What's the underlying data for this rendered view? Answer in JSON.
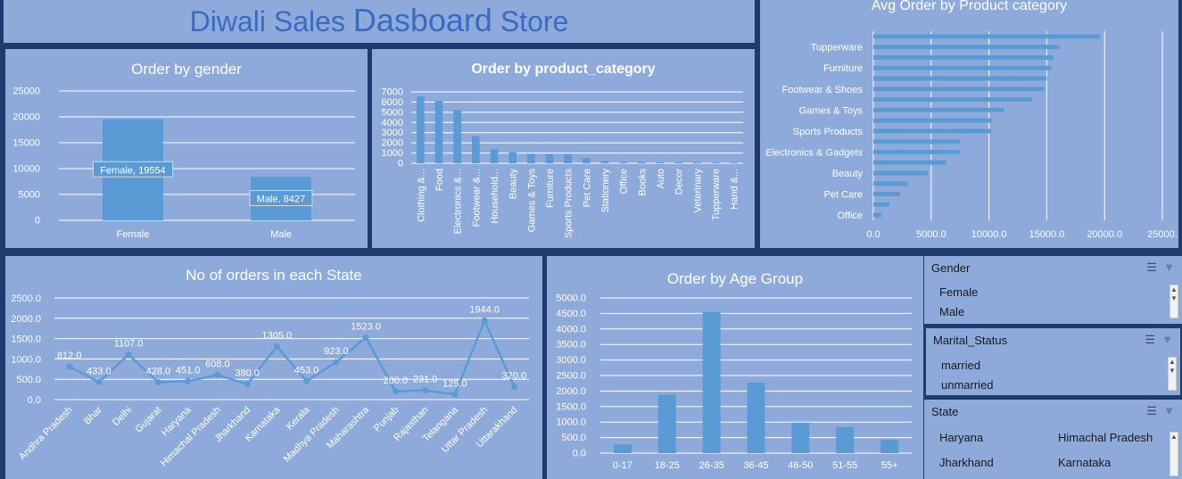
{
  "dashboard_title": {
    "part1": "Diwali Sales ",
    "part2": "Dasboard",
    "part3": " Store"
  },
  "colors": {
    "panel": "#8eaadb",
    "bar": "#5b9bd5",
    "background": "#1f3a6e",
    "title_text": "#3a6bc4",
    "gridline": "#ffffff"
  },
  "slicers": {
    "gender": {
      "title": "Gender",
      "items": [
        "Female",
        "Male"
      ]
    },
    "marital": {
      "title": "Marital_Status",
      "items": [
        "married",
        "unmarried"
      ]
    },
    "state": {
      "title": "State",
      "items": [
        "Haryana",
        "Himachal Pradesh",
        "Jharkhand",
        "Karnataka"
      ]
    },
    "icons": [
      "multi-select-icon",
      "clear-filter-icon"
    ]
  },
  "chart_data": [
    {
      "id": "gender",
      "type": "bar",
      "title": "Order by gender",
      "categories": [
        "Female",
        "Male"
      ],
      "values": [
        19554,
        8427
      ],
      "data_labels": [
        "Female, 19554",
        "Male, 8427"
      ],
      "ylim": [
        0,
        25000
      ],
      "yticks": [
        "0",
        "5000",
        "10000",
        "15000",
        "20000",
        "25000"
      ],
      "grid": true
    },
    {
      "id": "category",
      "type": "bar",
      "title": "Order by product_category",
      "categories": [
        "Clothing &...",
        "Food",
        "Electronics &...",
        "Footwear &...",
        "Household...",
        "Beauty",
        "Games & Toys",
        "Furniture",
        "Sports Products",
        "Pet Care",
        "Stationery",
        "Office",
        "Books",
        "Auto",
        "Decor",
        "Veterinary",
        "Tupperware",
        "Hand &..."
      ],
      "values": [
        6550,
        6110,
        5220,
        2640,
        1370,
        1070,
        920,
        870,
        870,
        480,
        210,
        110,
        100,
        90,
        90,
        80,
        70,
        50
      ],
      "ylim": [
        0,
        7000
      ],
      "yticks": [
        "0",
        "1000",
        "2000",
        "3000",
        "4000",
        "5000",
        "6000",
        "7000"
      ],
      "grid": true
    },
    {
      "id": "avg",
      "type": "bar",
      "title": "Avg Order by Product category",
      "orientation": "horizontal",
      "categories": [
        "Office",
        "",
        "Pet Care",
        "",
        "Beauty",
        "",
        "Electronics & Gadgets",
        "",
        "Sports Products",
        "",
        "Games & Toys",
        "",
        "Footwear & Shoes",
        "",
        "Furniture",
        "",
        "Tupperware",
        ""
      ],
      "values": [
        700,
        1400,
        2300,
        3000,
        4700,
        6300,
        7500,
        7500,
        10200,
        10300,
        11300,
        13700,
        14800,
        15000,
        15400,
        15600,
        16100,
        19600
      ],
      "xlim": [
        0,
        25000
      ],
      "xticks": [
        "0.0",
        "5000.0",
        "10000.0",
        "15000.0",
        "20000.0",
        "25000."
      ],
      "grid": true
    },
    {
      "id": "state",
      "type": "line",
      "title": "No of orders in each State",
      "categories": [
        "Andhra Pradesh",
        "Bhar",
        "Delhi",
        "Gujarat",
        "Haryana",
        "Himachal Pradesh",
        "Jharkhand",
        "Karnataka",
        "Kerala",
        "Madhya Pradesh",
        "Maharashtra",
        "Punjab",
        "Rajasthan",
        "Telangana",
        "Uttar Pradesh",
        "Uttarakhand"
      ],
      "values": [
        812,
        433,
        1107,
        428,
        451,
        608,
        380,
        1305,
        453,
        923,
        1523,
        200,
        231,
        125,
        1944,
        320
      ],
      "data_labels": [
        "812.0",
        "433.0",
        "1107.0",
        "428.0",
        "451.0",
        "608.0",
        "380.0",
        "1305.0",
        "453.0",
        "923.0",
        "1523.0",
        "200.0",
        "231.0",
        "125.0",
        "1944.0",
        "320.0"
      ],
      "ylim": [
        0,
        2500
      ],
      "yticks": [
        "0.0",
        "500.0",
        "1000.0",
        "1500.0",
        "2000.0",
        "2500.0"
      ],
      "grid": true
    },
    {
      "id": "age",
      "type": "bar",
      "title": "Order by Age Group",
      "categories": [
        "0-17",
        "18-25",
        "26-35",
        "36-45",
        "46-50",
        "51-55",
        "55+"
      ],
      "values": [
        280,
        1880,
        4540,
        2280,
        980,
        840,
        440
      ],
      "ylim": [
        0,
        5000
      ],
      "yticks": [
        "0.0",
        "500.0",
        "1000.0",
        "1500.0",
        "2000.0",
        "2500.0",
        "3000.0",
        "3500.0",
        "4000.0",
        "4500.0",
        "5000.0"
      ],
      "grid": true
    }
  ]
}
